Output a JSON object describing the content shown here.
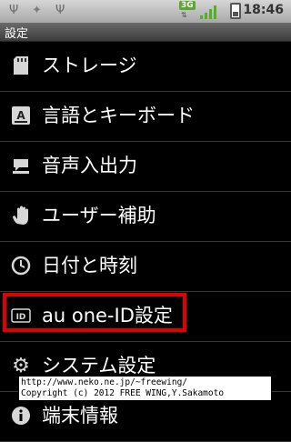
{
  "status_bar": {
    "time": "18:46",
    "network": "3G",
    "icons": [
      "usb-icon",
      "android-debug-icon",
      "usb-icon",
      "3g-icon",
      "signal-icon",
      "battery-icon"
    ]
  },
  "title": "設定",
  "items": [
    {
      "label": "ストレージ",
      "icon": "storage-icon"
    },
    {
      "label": "言語とキーボード",
      "icon": "keyboard-icon"
    },
    {
      "label": "音声入出力",
      "icon": "voice-icon"
    },
    {
      "label": "ユーザー補助",
      "icon": "accessibility-icon"
    },
    {
      "label": "日付と時刻",
      "icon": "clock-icon"
    },
    {
      "label": "au one-ID設定",
      "icon": "id-icon"
    },
    {
      "label": "システム設定",
      "icon": "gear-icon"
    },
    {
      "label": "端末情報",
      "icon": "info-icon"
    }
  ],
  "highlight_color": "#e00000",
  "credit": {
    "line1": "http://www.neko.ne.jp/~freewing/",
    "line2": "Copyright (c) 2012 FREE WING,Y.Sakamoto"
  }
}
